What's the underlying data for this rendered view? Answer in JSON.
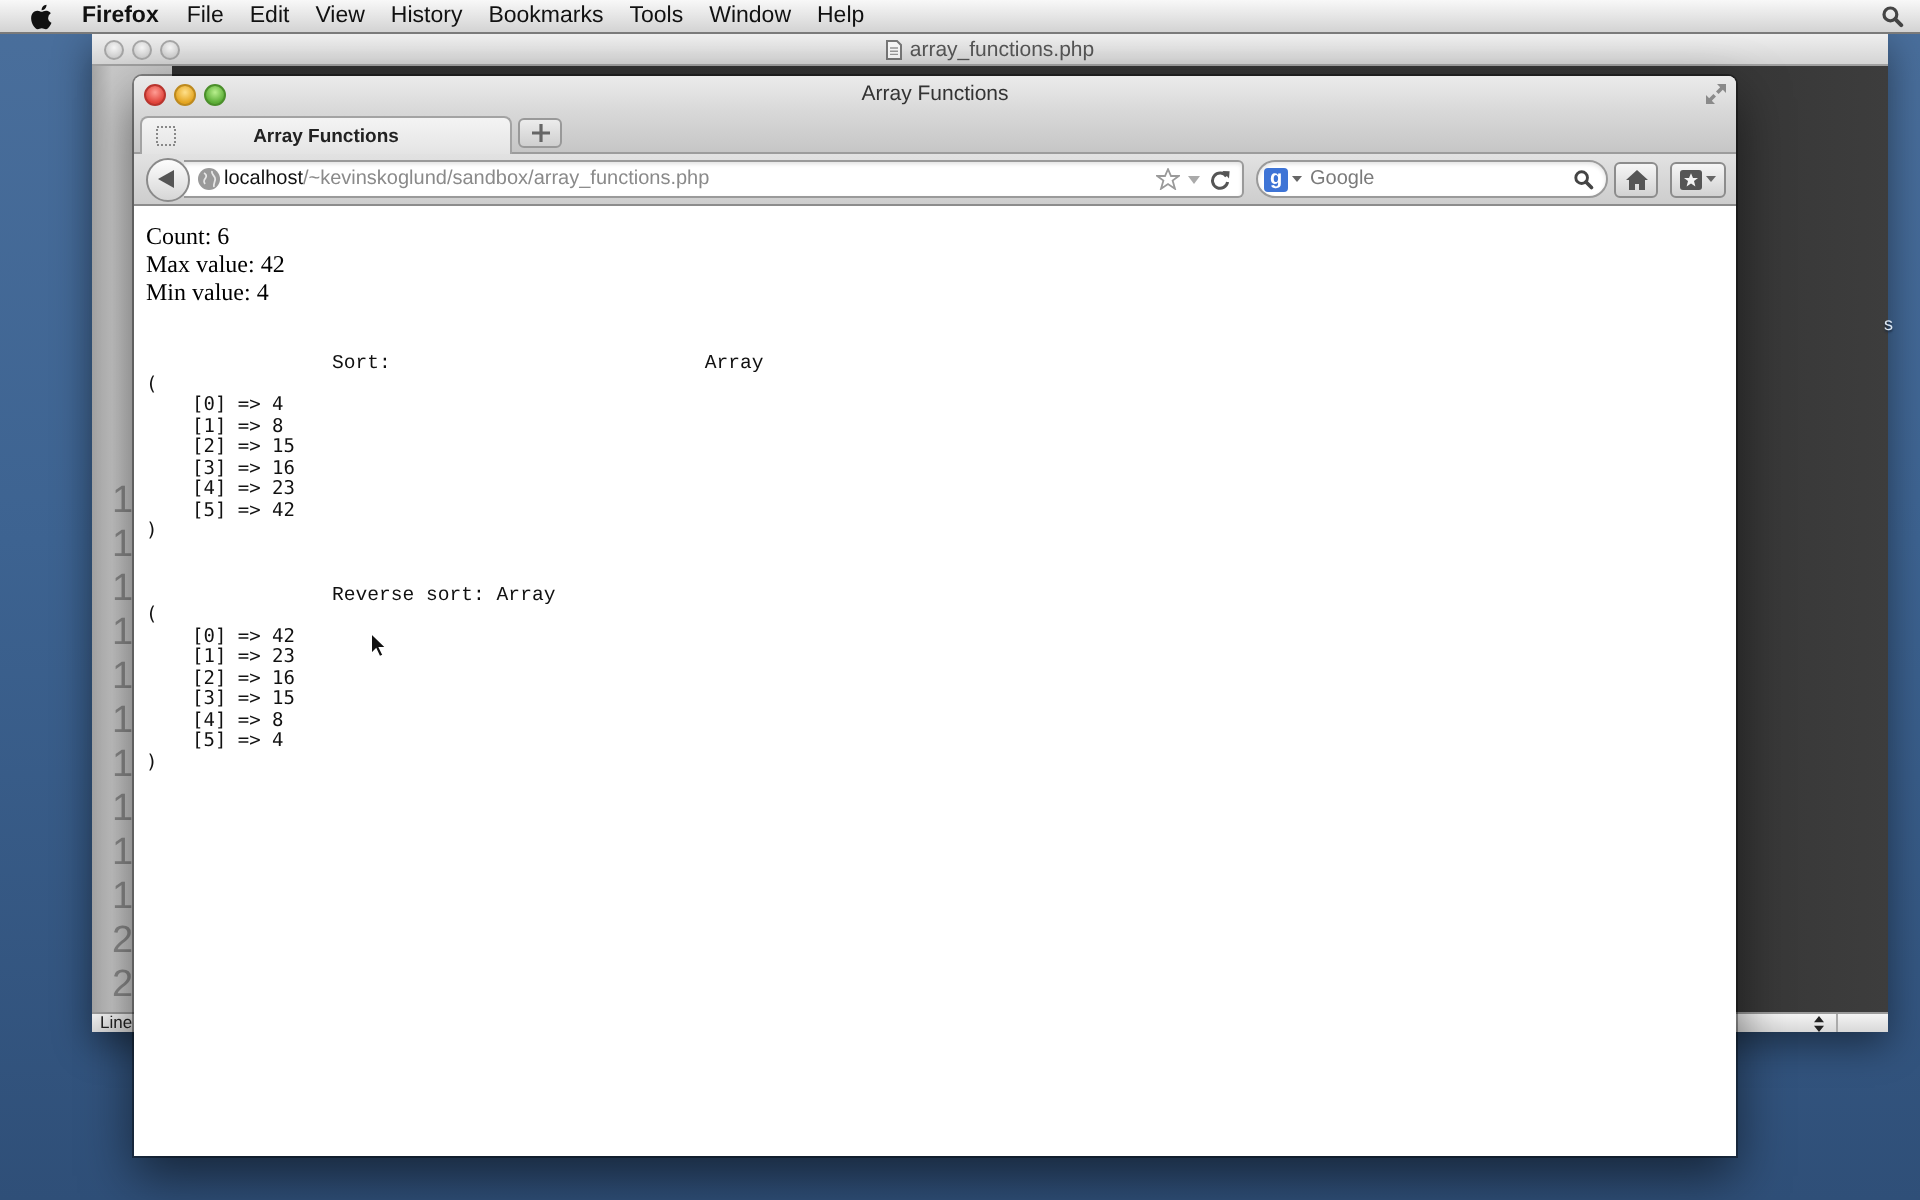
{
  "menu_bar": {
    "app_name": "Firefox",
    "items": [
      "File",
      "Edit",
      "View",
      "History",
      "Bookmarks",
      "Tools",
      "Window",
      "Help"
    ]
  },
  "editor_window": {
    "title": "array_functions.php",
    "line_numbers": [
      "1",
      "1",
      "1",
      "1",
      "1",
      "1",
      "1",
      "1",
      "1",
      "1",
      "2",
      "2"
    ],
    "status_text": "Line"
  },
  "desktop_label": "s",
  "browser_window": {
    "title": "Array Functions",
    "tabs": [
      {
        "label": "Array Functions",
        "selected": true
      }
    ],
    "address": {
      "host": "localhost",
      "path": "/~kevinskoglund/sandbox/array_functions.php"
    },
    "search": {
      "engine_badge": "g",
      "placeholder": "Google"
    }
  },
  "page": {
    "stats": [
      "Count: 6",
      "Max value: 42",
      "Min value: 4"
    ],
    "blocks": [
      {
        "heading": [
          "Sort:",
          "Array"
        ],
        "open": "(",
        "lines": [
          "[0] => 4",
          "[1] => 8",
          "[2] => 15",
          "[3] => 16",
          "[4] => 23",
          "[5] => 42"
        ],
        "close": ")"
      },
      {
        "heading": [
          "Reverse sort: Array"
        ],
        "open": "(",
        "lines": [
          "[0] => 42",
          "[1] => 23",
          "[2] => 16",
          "[3] => 15",
          "[4] => 8",
          "[5] => 4"
        ],
        "close": ")"
      }
    ]
  }
}
